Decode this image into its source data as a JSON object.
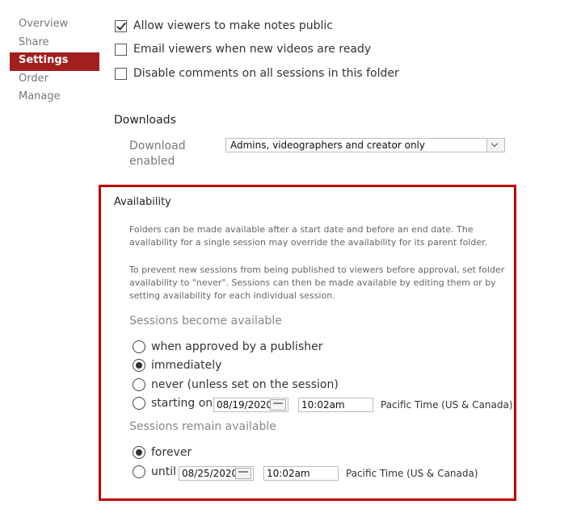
{
  "sidebar": {
    "items": [
      {
        "label": "Overview"
      },
      {
        "label": "Share"
      },
      {
        "label": "Settings"
      },
      {
        "label": "Order"
      },
      {
        "label": "Manage"
      }
    ]
  },
  "options": {
    "notes_public": {
      "label": "Allow viewers to make notes public",
      "checked": true
    },
    "email_viewers": {
      "label": "Email viewers when new videos are ready",
      "checked": false
    },
    "disable_comments": {
      "label": "Disable comments on all sessions in this folder",
      "checked": false
    }
  },
  "downloads": {
    "title": "Downloads",
    "label": "Download enabled",
    "selected": "Admins, videographers and creator only"
  },
  "availability": {
    "title": "Availability",
    "para1": "Folders can be made available after a start date and before an end date. The availability for a single session may override the availability for its parent folder.",
    "para2": "To prevent new sessions from being published to viewers before approval, set folder availability to \"never\". Sessions can then be made available by editing them or by setting availability for each individual session.",
    "become": {
      "label": "Sessions become available",
      "options": [
        {
          "label": "when approved by a publisher",
          "checked": false
        },
        {
          "label": "immediately",
          "checked": true
        },
        {
          "label": "never (unless set on the session)",
          "checked": false
        },
        {
          "label": "starting on",
          "checked": false
        }
      ],
      "date": "08/19/2020",
      "time": "10:02am",
      "timezone": "Pacific Time (US & Canada)"
    },
    "remain": {
      "label": "Sessions remain available",
      "options": [
        {
          "label": "forever",
          "checked": true
        },
        {
          "label": "until",
          "checked": false
        }
      ],
      "date": "08/25/2020",
      "time": "10:02am",
      "timezone": "Pacific Time (US & Canada)"
    }
  },
  "colors": {
    "accent": "#a31f1e",
    "highlight_border": "#c00000"
  }
}
